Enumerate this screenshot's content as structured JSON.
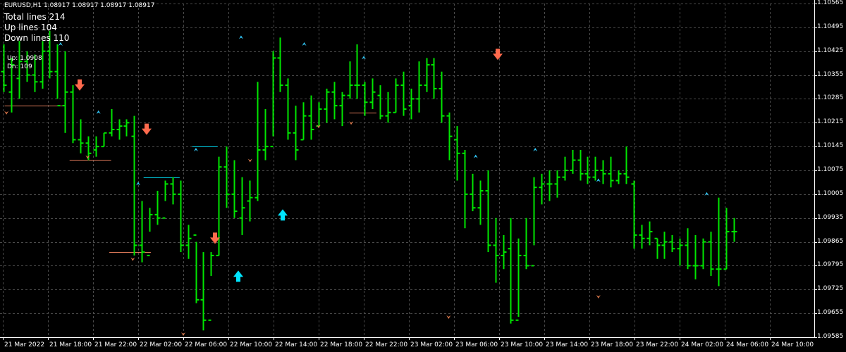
{
  "header": {
    "symbol": "EURUSD,H1",
    "ohlc": "1.08917 1.08917 1.08917 1.08917"
  },
  "stats": {
    "total_lines": "Total lines 214",
    "up_lines": "Up lines 104",
    "down_lines": "Down lines 110",
    "up_price": "Up: 1.0908",
    "dn_value": "Dn: 109"
  },
  "colors": {
    "background": "#000000",
    "grid": "#4a4a4a",
    "bar": "#00e600",
    "axis_text": "#ffffff",
    "up_arrow": "#00e5ff",
    "down_arrow": "#ff6a4d",
    "up_line": "#00d0e8",
    "down_line": "#e07a5a",
    "small_up": "#33ccff",
    "small_down": "#d9774a"
  },
  "chart_data": {
    "type": "bar",
    "symbol": "EURUSD",
    "timeframe": "H1",
    "y_ticks": [
      1.10565,
      1.10495,
      1.10425,
      1.10355,
      1.10285,
      1.10215,
      1.10145,
      1.10075,
      1.10005,
      1.09935,
      1.09865,
      1.09795,
      1.09725,
      1.09655,
      1.09585
    ],
    "y_labels": [
      "1.10565",
      "1.10495",
      "1.10425",
      "1.10355",
      "1.10285",
      "1.10215",
      "1.10145",
      "1.10075",
      "1.10005",
      "1.09935",
      "1.09865",
      "1.09795",
      "1.09725",
      "1.09655",
      "1.09585"
    ],
    "ylim": [
      1.09585,
      1.10565
    ],
    "x_labels": [
      "21 Mar 2022",
      "21 Mar 18:00",
      "21 Mar 22:00",
      "22 Mar 02:00",
      "22 Mar 06:00",
      "22 Mar 10:00",
      "22 Mar 14:00",
      "22 Mar 18:00",
      "22 Mar 22:00",
      "23 Mar 02:00",
      "23 Mar 06:00",
      "23 Mar 10:00",
      "23 Mar 14:00",
      "23 Mar 18:00",
      "23 Mar 22:00",
      "24 Mar 02:00",
      "24 Mar 06:00",
      "24 Mar 10:00"
    ],
    "bars": [
      [
        1.10365,
        1.10445,
        1.10305,
        1.10325
      ],
      [
        1.10305,
        1.10405,
        1.10245,
        1.10385
      ],
      [
        1.10345,
        1.10455,
        1.10285,
        1.10395
      ],
      [
        1.10395,
        1.10425,
        1.10335,
        1.10355
      ],
      [
        1.10355,
        1.10415,
        1.10305,
        1.10335
      ],
      [
        1.10335,
        1.10455,
        1.10315,
        1.10425
      ],
      [
        1.10425,
        1.10485,
        1.10345,
        1.10365
      ],
      [
        1.10365,
        1.10445,
        1.10285,
        1.10265
      ],
      [
        1.10265,
        1.10425,
        1.10185,
        1.10305
      ],
      [
        1.10305,
        1.10325,
        1.10155,
        1.10165
      ],
      [
        1.10165,
        1.10225,
        1.10125,
        1.10155
      ],
      [
        1.10155,
        1.10175,
        1.10105,
        1.10125
      ],
      [
        1.10135,
        1.10175,
        1.10115,
        1.10145
      ],
      [
        1.10145,
        1.10185,
        1.10145,
        1.10185
      ],
      [
        1.10185,
        1.10255,
        1.10175,
        1.10195
      ],
      [
        1.10195,
        1.10225,
        1.10165,
        1.10205
      ],
      [
        1.10205,
        1.10225,
        1.10175,
        1.10215
      ],
      [
        1.10175,
        1.10235,
        1.09825,
        1.09855
      ],
      [
        1.09855,
        1.09985,
        1.09805,
        1.09835
      ],
      [
        1.09825,
        1.09965,
        1.09895,
        1.09945
      ],
      [
        1.09945,
        1.10015,
        1.09915,
        1.09935
      ],
      [
        1.09935,
        1.10045,
        1.09985,
        1.10035
      ],
      [
        1.10035,
        1.10055,
        1.09975,
        1.10005
      ],
      [
        1.10005,
        1.10045,
        1.09835,
        1.09855
      ],
      [
        1.09855,
        1.09915,
        1.09815,
        1.09875
      ],
      [
        1.09885,
        1.09865,
        1.09685,
        1.09695
      ],
      [
        1.09695,
        1.09835,
        1.09605,
        1.09635
      ],
      [
        1.09635,
        1.09835,
        1.09765,
        1.09825
      ],
      [
        1.09825,
        1.10115,
        1.09825,
        1.10085
      ],
      [
        1.10085,
        1.10145,
        1.09965,
        1.10005
      ],
      [
        1.10005,
        1.10105,
        1.09935,
        1.09955
      ],
      [
        1.09935,
        1.10055,
        1.09885,
        1.09965
      ],
      [
        1.09985,
        1.10045,
        1.09925,
        1.09995
      ],
      [
        1.09995,
        1.10335,
        1.09985,
        1.10135
      ],
      [
        1.10135,
        1.10255,
        1.10105,
        1.10145
      ],
      [
        1.10145,
        1.10425,
        1.10175,
        1.10405
      ],
      [
        1.10405,
        1.10465,
        1.10305,
        1.10325
      ],
      [
        1.10325,
        1.10345,
        1.10165,
        1.10185
      ],
      [
        1.10185,
        1.10265,
        1.10105,
        1.10135
      ],
      [
        1.10165,
        1.10275,
        1.10165,
        1.10235
      ],
      [
        1.10235,
        1.10295,
        1.10165,
        1.10195
      ],
      [
        1.10205,
        1.10275,
        1.10205,
        1.10255
      ],
      [
        1.10255,
        1.10315,
        1.10215,
        1.10305
      ],
      [
        1.10305,
        1.10335,
        1.10225,
        1.10265
      ],
      [
        1.10265,
        1.10305,
        1.10205,
        1.10295
      ],
      [
        1.10295,
        1.10395,
        1.10285,
        1.10325
      ],
      [
        1.10325,
        1.10445,
        1.10285,
        1.10325
      ],
      [
        1.10325,
        1.10335,
        1.10235,
        1.10275
      ],
      [
        1.10275,
        1.10345,
        1.10255,
        1.10305
      ],
      [
        1.10295,
        1.10325,
        1.10225,
        1.10235
      ],
      [
        1.10235,
        1.10305,
        1.10215,
        1.10245
      ],
      [
        1.10245,
        1.10345,
        1.10245,
        1.10325
      ],
      [
        1.10325,
        1.10365,
        1.10235,
        1.10255
      ],
      [
        1.10265,
        1.10315,
        1.10225,
        1.10285
      ],
      [
        1.10285,
        1.10395,
        1.10245,
        1.10325
      ],
      [
        1.10325,
        1.10405,
        1.10305,
        1.10385
      ],
      [
        1.10385,
        1.10405,
        1.10285,
        1.10315
      ],
      [
        1.10315,
        1.10365,
        1.10215,
        1.10235
      ],
      [
        1.10235,
        1.10245,
        1.10105,
        1.10175
      ],
      [
        1.10165,
        1.10205,
        1.10045,
        1.10125
      ],
      [
        1.10125,
        1.10135,
        1.09905,
        1.10005
      ],
      [
        1.10005,
        1.10065,
        1.09955,
        1.09965
      ],
      [
        1.09965,
        1.10045,
        1.09915,
        1.10015
      ],
      [
        1.10015,
        1.10075,
        1.09835,
        1.09855
      ],
      [
        1.09855,
        1.09935,
        1.09745,
        1.09825
      ],
      [
        1.09825,
        1.09885,
        1.09785,
        1.09835
      ],
      [
        1.09845,
        1.09935,
        1.09625,
        1.09635
      ],
      [
        1.09635,
        1.09875,
        1.09645,
        1.09825
      ],
      [
        1.09825,
        1.09935,
        1.09785,
        1.09795
      ],
      [
        1.09795,
        1.10055,
        1.09855,
        1.10025
      ],
      [
        1.10025,
        1.10065,
        1.09975,
        1.10035
      ],
      [
        1.10035,
        1.10075,
        1.09985,
        1.10035
      ],
      [
        1.10035,
        1.10075,
        1.09995,
        1.10055
      ],
      [
        1.10055,
        1.10115,
        1.10045,
        1.10075
      ],
      [
        1.10075,
        1.10135,
        1.10065,
        1.10105
      ],
      [
        1.10105,
        1.10135,
        1.10045,
        1.10065
      ],
      [
        1.10065,
        1.10115,
        1.10035,
        1.10055
      ],
      [
        1.10055,
        1.10115,
        1.10045,
        1.10075
      ],
      [
        1.10075,
        1.10105,
        1.10035,
        1.10065
      ],
      [
        1.10065,
        1.10115,
        1.10025,
        1.10045
      ],
      [
        1.10045,
        1.10075,
        1.10035,
        1.10065
      ],
      [
        1.10065,
        1.10145,
        1.10035,
        1.10055
      ],
      [
        1.10035,
        1.10045,
        1.09845,
        1.09885
      ],
      [
        1.09885,
        1.09915,
        1.09845,
        1.09875
      ],
      [
        1.09875,
        1.09925,
        1.09855,
        1.09895
      ],
      [
        1.09875,
        1.09875,
        1.09815,
        1.09855
      ],
      [
        1.09855,
        1.09895,
        1.09815,
        1.09865
      ],
      [
        1.09865,
        1.09885,
        1.09835,
        1.09845
      ],
      [
        1.09845,
        1.09875,
        1.09795,
        1.09855
      ],
      [
        1.09855,
        1.09905,
        1.09785,
        1.09795
      ],
      [
        1.09795,
        1.09885,
        1.09755,
        1.09795
      ],
      [
        1.09795,
        1.09875,
        1.09785,
        1.09865
      ],
      [
        1.09865,
        1.09895,
        1.09765,
        1.09785
      ],
      [
        1.09785,
        1.09995,
        1.09735,
        1.09785
      ],
      [
        1.09785,
        1.09965,
        1.09785,
        1.09895
      ],
      [
        1.09895,
        1.09935,
        1.09865,
        1.09895
      ]
    ],
    "up_arrows": [
      [
        10,
        1.09785
      ],
      [
        11,
        1.09965
      ]
    ],
    "down_arrows": [
      [
        5,
        1.10305
      ],
      [
        10,
        1.10175
      ],
      [
        18,
        1.09855
      ],
      [
        21,
        1.10395
      ]
    ],
    "small_up": [
      [
        0.32,
        1.10445
      ],
      [
        0.53,
        1.10245
      ],
      [
        0.75,
        1.10035
      ],
      [
        1.07,
        1.10135
      ],
      [
        1.32,
        1.10465
      ],
      [
        1.67,
        1.10445
      ],
      [
        2.0,
        1.10405
      ],
      [
        2.62,
        1.10115
      ],
      [
        2.95,
        1.10135
      ],
      [
        3.3,
        1.10045
      ],
      [
        3.9,
        1.10005
      ]
    ],
    "small_down": [
      [
        0.02,
        1.10245
      ],
      [
        0.47,
        1.10115
      ],
      [
        0.72,
        1.09815
      ],
      [
        1.0,
        1.09595
      ],
      [
        1.37,
        1.10105
      ],
      [
        1.75,
        1.10205
      ],
      [
        1.93,
        1.10215
      ],
      [
        2.47,
        1.09645
      ],
      [
        3.3,
        1.09705
      ]
    ],
    "up_levels": [
      [
        0.78,
        0.98,
        1.10055
      ],
      [
        1.05,
        1.19,
        1.10145
      ]
    ],
    "down_levels": [
      [
        0.01,
        0.33,
        1.10265
      ],
      [
        0.37,
        0.6,
        1.10105
      ],
      [
        0.59,
        0.82,
        1.09835
      ],
      [
        1.92,
        2.07,
        1.10245
      ]
    ]
  }
}
